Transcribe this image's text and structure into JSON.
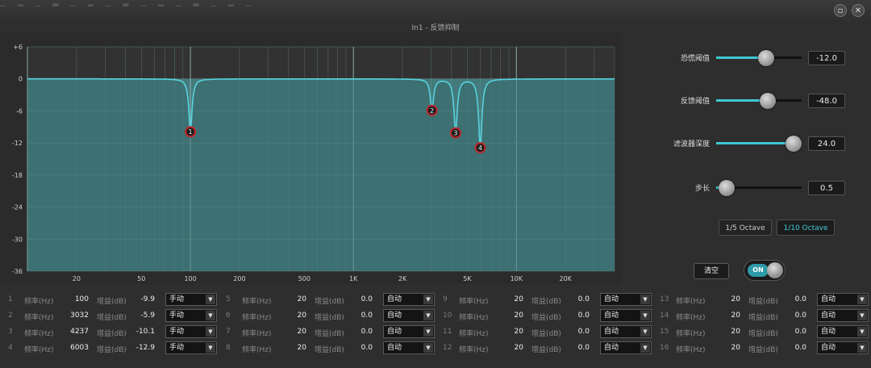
{
  "window": {
    "title": "In1 - 反馈抑制",
    "buttons": [
      {
        "name": "minimize",
        "glyph": "▫"
      },
      {
        "name": "close",
        "glyph": "✕"
      }
    ]
  },
  "graph": {
    "y_ticks": [
      "+6",
      "0",
      "-6",
      "-12",
      "-18",
      "-24",
      "-30",
      "-36"
    ],
    "y_range": [
      -36,
      6
    ],
    "x_range_hz": [
      10,
      40000
    ],
    "x_tick_labels": [
      {
        "hz": 20,
        "label": "20"
      },
      {
        "hz": 50,
        "label": "50"
      },
      {
        "hz": 100,
        "label": "100"
      },
      {
        "hz": 200,
        "label": "200"
      },
      {
        "hz": 500,
        "label": "500"
      },
      {
        "hz": 1000,
        "label": "1K"
      },
      {
        "hz": 2000,
        "label": "2K"
      },
      {
        "hz": 5000,
        "label": "5K"
      },
      {
        "hz": 10000,
        "label": "10K"
      },
      {
        "hz": 20000,
        "label": "20K"
      }
    ],
    "curve_color": "#56d3de",
    "fill_color": "#4a8c8e",
    "marker_color": "#c0262b"
  },
  "controls": {
    "sliders": [
      {
        "label": "恐慌阈值",
        "value": "-12.0",
        "level": 0.6
      },
      {
        "label": "反馈阈值",
        "value": "-48.0",
        "level": 0.63
      },
      {
        "label": "滤波器深度",
        "value": "24.0",
        "level": 1.0
      },
      {
        "label": "步长",
        "value": "0.5",
        "level": 0.03
      }
    ],
    "octave_buttons": [
      {
        "label": "1/5 Octave",
        "active": false
      },
      {
        "label": "1/10 Octave",
        "active": true
      }
    ],
    "clear_label": "清空",
    "toggle_label": "ON",
    "accent": "#3fc8d4"
  },
  "filters": {
    "freq_label": "频率(Hz)",
    "gain_label": "增益(dB)",
    "mode_auto": "自动",
    "mode_manual": "手动",
    "items": [
      {
        "idx": "1",
        "freq": "100",
        "gain": "-9.9",
        "mode": "手动"
      },
      {
        "idx": "2",
        "freq": "3032",
        "gain": "-5.9",
        "mode": "手动"
      },
      {
        "idx": "3",
        "freq": "4237",
        "gain": "-10.1",
        "mode": "手动"
      },
      {
        "idx": "4",
        "freq": "6003",
        "gain": "-12.9",
        "mode": "手动"
      },
      {
        "idx": "5",
        "freq": "20",
        "gain": "0.0",
        "mode": "自动"
      },
      {
        "idx": "6",
        "freq": "20",
        "gain": "0.0",
        "mode": "自动"
      },
      {
        "idx": "7",
        "freq": "20",
        "gain": "0.0",
        "mode": "自动"
      },
      {
        "idx": "8",
        "freq": "20",
        "gain": "0.0",
        "mode": "自动"
      },
      {
        "idx": "9",
        "freq": "20",
        "gain": "0.0",
        "mode": "自动"
      },
      {
        "idx": "10",
        "freq": "20",
        "gain": "0.0",
        "mode": "自动"
      },
      {
        "idx": "11",
        "freq": "20",
        "gain": "0.0",
        "mode": "自动"
      },
      {
        "idx": "12",
        "freq": "20",
        "gain": "0.0",
        "mode": "自动"
      },
      {
        "idx": "13",
        "freq": "20",
        "gain": "0.0",
        "mode": "自动"
      },
      {
        "idx": "14",
        "freq": "20",
        "gain": "0.0",
        "mode": "自动"
      },
      {
        "idx": "15",
        "freq": "20",
        "gain": "0.0",
        "mode": "自动"
      },
      {
        "idx": "16",
        "freq": "20",
        "gain": "0.0",
        "mode": "自动"
      }
    ]
  }
}
